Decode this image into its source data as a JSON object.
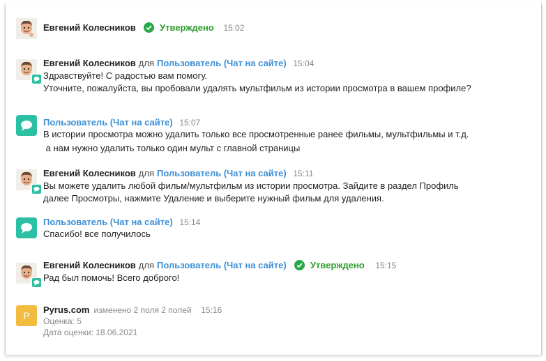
{
  "messages": [
    {
      "author": "Евгений Колесников",
      "status": "Утверждено",
      "time": "15:02"
    },
    {
      "author": "Евгений Колесников",
      "for_word": "для",
      "recipient": "Пользователь (Чат на сайте)",
      "time": "15:04",
      "lines": [
        "Здравствуйте! С радостью вам помогу.",
        "Уточните, пожалуйста, вы пробовали удалять мультфильм из истории просмотра в вашем профиле?"
      ]
    },
    {
      "author": "Пользователь (Чат на сайте)",
      "time": "15:07",
      "lines": [
        "В истории просмотра можно удалить только все просмотренные ранее фильмы, мультфильмы и т.д.",
        " а нам нужно удалить только один мульт с главной страницы"
      ]
    },
    {
      "author": "Евгений Колесников",
      "for_word": "для",
      "recipient": "Пользователь (Чат на сайте)",
      "time": "15:11",
      "lines": [
        "Вы можете удалить любой фильм/мультфильм из истории просмотра. Зайдите в раздел Профиль",
        "далее Просмотры, нажмите Удаление и выберите нужный фильм для удаления."
      ]
    },
    {
      "author": "Пользователь (Чат на сайте)",
      "time": "15:14",
      "lines": [
        "Спасибо! все получилось"
      ]
    },
    {
      "author": "Евгений Колесников",
      "for_word": "для",
      "recipient": "Пользователь (Чат на сайте)",
      "status": "Утверждено",
      "time": "15:15",
      "lines": [
        "Рад был помочь! Всего доброго!"
      ]
    },
    {
      "author": "Pyrus.com",
      "avatar_letter": "P",
      "changed": "изменено 2 поля 2 полей",
      "time": "15:16",
      "fields": [
        "Оценка: 5",
        "Дата оценки: 18.06.2021"
      ]
    }
  ],
  "colors": {
    "link": "#3d8fd6",
    "approved": "#2e9d2e",
    "chat_avatar": "#2bbfa3",
    "pyrus_avatar": "#f2bc3e"
  },
  "icons": {
    "user_avatar": "memoji-face-avatar",
    "chat": "chat-bubble-icon",
    "approved": "check-circle-icon"
  }
}
